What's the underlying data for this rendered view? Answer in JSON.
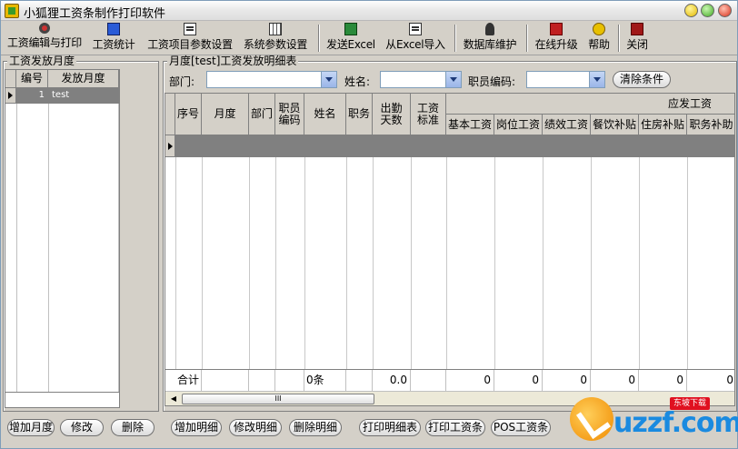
{
  "window": {
    "title": "小狐狸工资条制作打印软件"
  },
  "toolbar": {
    "items": [
      {
        "label": "工资编辑与打印",
        "icon": "gear-icon"
      },
      {
        "label": "工资统计",
        "icon": "report-icon"
      },
      {
        "label": "工资项目参数设置",
        "icon": "save-icon"
      },
      {
        "label": "系统参数设置",
        "icon": "grid-icon"
      },
      {
        "label": "发送Excel",
        "icon": "excel-send-icon"
      },
      {
        "label": "从Excel导入",
        "icon": "excel-import-icon"
      },
      {
        "label": "数据库维护",
        "icon": "database-icon"
      },
      {
        "label": "在线升级",
        "icon": "upgrade-icon"
      },
      {
        "label": "帮助",
        "icon": "help-icon"
      },
      {
        "label": "关闭",
        "icon": "exit-icon"
      }
    ]
  },
  "left_panel": {
    "title": "工资发放月度",
    "columns": [
      "编号",
      "发放月度"
    ],
    "rows": [
      {
        "id": "1",
        "month": "test"
      }
    ],
    "buttons": [
      "增加月度",
      "修改",
      "删除"
    ]
  },
  "right_panel": {
    "title": "月度[test]工资发放明细表",
    "filters": {
      "dept_label": "部门:",
      "name_label": "姓名:",
      "code_label": "职员编码:",
      "clear_button": "清除条件"
    },
    "columns": [
      "序号",
      "月度",
      "部门",
      "职员编码",
      "姓名",
      "职务",
      "出勤天数",
      "工资标准"
    ],
    "group_header": "应发工资",
    "sub_columns": [
      "基本工资",
      "岗位工资",
      "绩效工资",
      "餐饮补贴",
      "住房补贴",
      "职务补助"
    ],
    "total_row": {
      "label": "合计",
      "name_count": "0条",
      "attendance": "0.0",
      "values": [
        "0",
        "0",
        "0",
        "0",
        "0",
        "0"
      ]
    },
    "scroll_thumb": "III",
    "buttons": [
      "增加明细",
      "修改明细",
      "删除明细",
      "打印明细表",
      "打印工资条",
      "POS工资条"
    ]
  },
  "watermark": {
    "text": "uzzf.com",
    "tag": "东坡下载"
  }
}
